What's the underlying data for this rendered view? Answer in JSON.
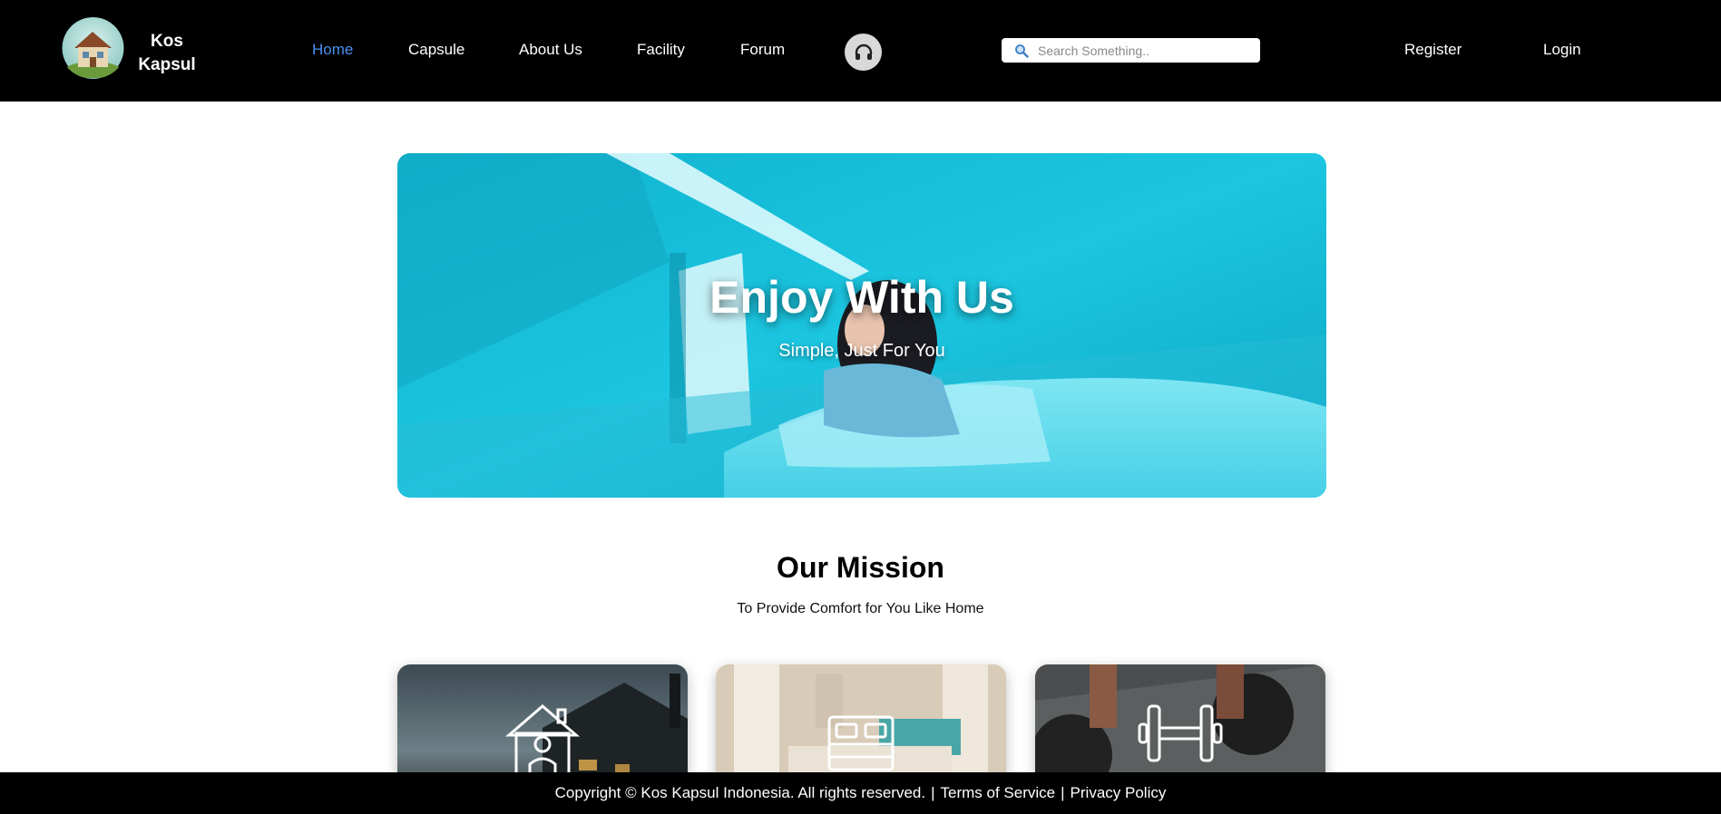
{
  "brand": {
    "line1": "Kos",
    "line2": "Kapsul"
  },
  "nav": {
    "items": [
      {
        "label": "Home",
        "active": true
      },
      {
        "label": "Capsule",
        "active": false
      },
      {
        "label": "About Us",
        "active": false
      },
      {
        "label": "Facility",
        "active": false
      },
      {
        "label": "Forum",
        "active": false
      }
    ],
    "support_icon": "headset-icon"
  },
  "search": {
    "placeholder": "Search Something..",
    "value": "",
    "icon": "search-icon"
  },
  "auth": {
    "register_label": "Register",
    "login_label": "Login"
  },
  "hero": {
    "title": "Enjoy With Us",
    "subtitle": "Simple, Just For You"
  },
  "mission": {
    "title": "Our Mission",
    "subtitle": "To Provide Comfort for You Like Home",
    "cards": [
      {
        "icon": "house-person-icon"
      },
      {
        "icon": "bed-icon"
      },
      {
        "icon": "dumbbell-icon"
      }
    ]
  },
  "footer": {
    "copyright": "Copyright © Kos Kapsul Indonesia. All rights reserved.",
    "sep1": "|",
    "terms_label": "Terms of Service",
    "sep2": "|",
    "privacy_label": "Privacy Policy"
  },
  "colors": {
    "header_bg": "#000000",
    "nav_active": "#4a8ff0",
    "hero_tint": "#1cc6e0",
    "footer_bg": "#000000"
  }
}
